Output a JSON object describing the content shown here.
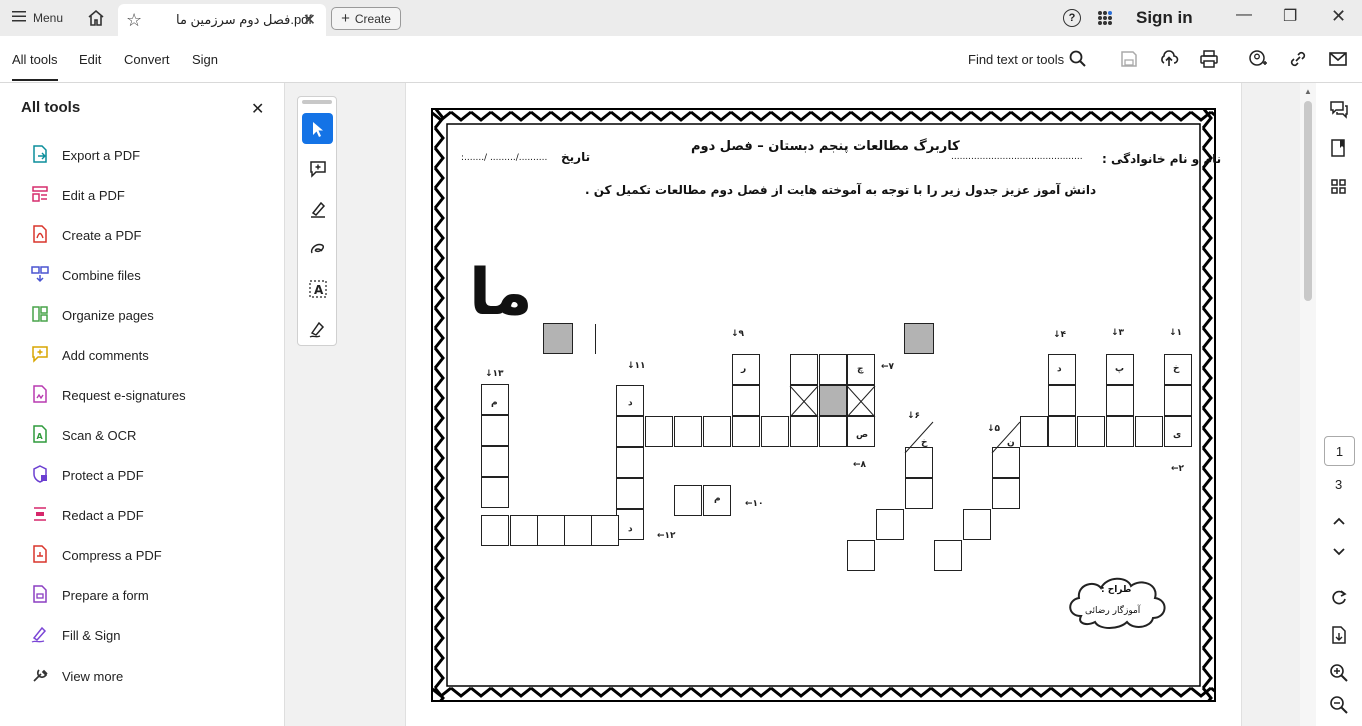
{
  "titlebar": {
    "menu_label": "Menu",
    "tab_title": "فصل دوم سرزمین ما.pdf",
    "create_label": "Create",
    "help_label": "?",
    "signin_label": "Sign in"
  },
  "toolbar": {
    "tabs": [
      {
        "label": "All tools",
        "active": true
      },
      {
        "label": "Edit",
        "active": false
      },
      {
        "label": "Convert",
        "active": false
      },
      {
        "label": "Sign",
        "active": false
      }
    ],
    "find_label": "Find text or tools"
  },
  "left_panel": {
    "title": "All tools",
    "items": [
      {
        "label": "Export a PDF",
        "icon": "export-pdf-icon",
        "color": "#0b8e9b"
      },
      {
        "label": "Edit a PDF",
        "icon": "edit-pdf-icon",
        "color": "#d62d6d"
      },
      {
        "label": "Create a PDF",
        "icon": "create-pdf-icon",
        "color": "#d9352b"
      },
      {
        "label": "Combine files",
        "icon": "combine-files-icon",
        "color": "#4a54d1"
      },
      {
        "label": "Organize pages",
        "icon": "organize-pages-icon",
        "color": "#49a44a"
      },
      {
        "label": "Add comments",
        "icon": "add-comments-icon",
        "color": "#d8a500"
      },
      {
        "label": "Request e-signatures",
        "icon": "request-esign-icon",
        "color": "#b83ab0"
      },
      {
        "label": "Scan & OCR",
        "icon": "scan-ocr-icon",
        "color": "#2f9a3c"
      },
      {
        "label": "Protect a PDF",
        "icon": "protect-pdf-icon",
        "color": "#6b3fd1"
      },
      {
        "label": "Redact a PDF",
        "icon": "redact-pdf-icon",
        "color": "#d6276b"
      },
      {
        "label": "Compress a PDF",
        "icon": "compress-pdf-icon",
        "color": "#d9352b"
      },
      {
        "label": "Prepare a form",
        "icon": "prepare-form-icon",
        "color": "#8b3fc2"
      },
      {
        "label": "Fill & Sign",
        "icon": "fill-sign-icon",
        "color": "#7b46d6"
      },
      {
        "label": "View more",
        "icon": "view-more-icon",
        "color": "#333333"
      }
    ]
  },
  "pager": {
    "current": "1",
    "total": "3"
  },
  "document": {
    "title": "کاربرگ مطالعات پنجم دبستان – فصل دوم",
    "name_label": "نام و نام خانوادگی :",
    "name_dots": "..............................................",
    "date_label": "تاریخ",
    "date_value": ":......./ ........./..........",
    "instruction": "دانش آموز عزیز جدول زیر را با توجه به آموخته هایت از فصل دوم مطالعات تکمیل کن .",
    "big_word": "ما",
    "designer_label": "طراح :",
    "designer_name": "آموزگار رضائی",
    "clue_numbers": {
      "n1": "۱",
      "n2": "۲",
      "n3": "۳",
      "n4": "۴",
      "n5": "۵",
      "n6": "۶",
      "n7": "۷",
      "n8": "۸",
      "n9": "۹",
      "n10": "۱۰",
      "n11": "۱۱",
      "n12": "۱۲",
      "n13": "۱۳"
    },
    "letters": {
      "kh1": "خ",
      "ye": "ی",
      "pe": "پ",
      "dal1": "د",
      "nun": "ن",
      "kh2": "خ",
      "che": "چ",
      "sad": "ص",
      "re": "ر",
      "mim1": "م",
      "dal2": "د",
      "dal3": "د",
      "mim2": "م"
    }
  }
}
